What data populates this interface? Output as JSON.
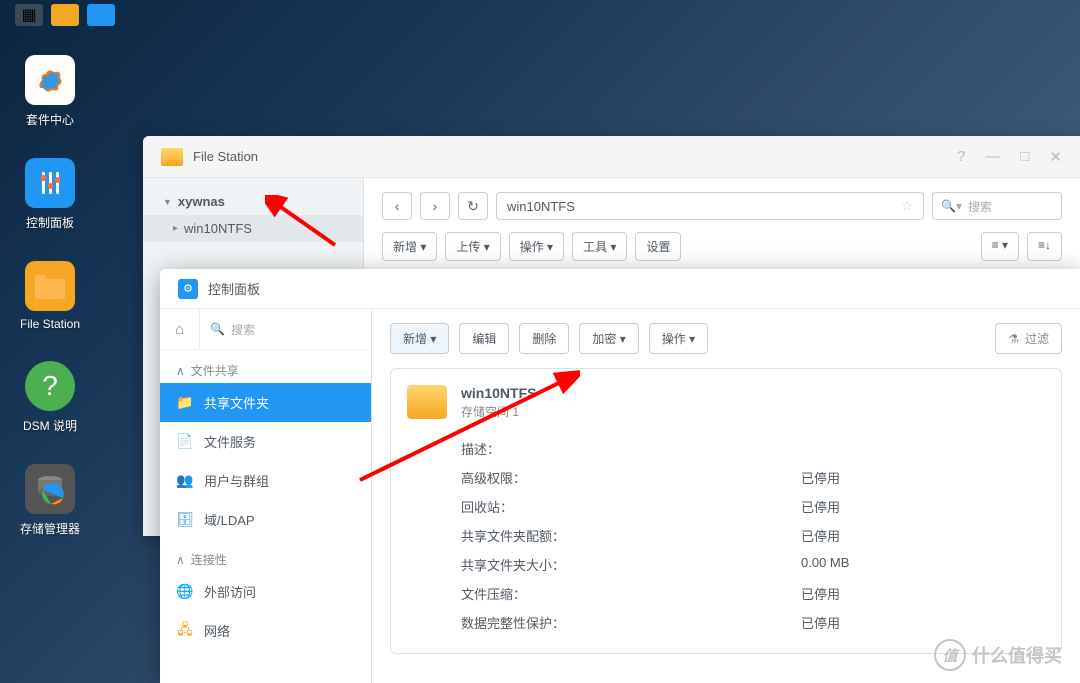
{
  "desktop": {
    "icons": [
      {
        "label": "套件中心",
        "glyph": "S"
      },
      {
        "label": "控制面板",
        "glyph": "⚙"
      },
      {
        "label": "File Station",
        "glyph": "📁"
      },
      {
        "label": "DSM 说明",
        "glyph": "?"
      },
      {
        "label": "存储管理器",
        "glyph": "💾"
      }
    ]
  },
  "fileStation": {
    "title": "File Station",
    "tree": {
      "root": "xywnas",
      "child": "win10NTFS"
    },
    "path": "win10NTFS",
    "searchPlaceholder": "搜索",
    "toolbar": {
      "new": "新增 ▾",
      "upload": "上传 ▾",
      "ops": "操作 ▾",
      "tools": "工具 ▾",
      "settings": "设置"
    }
  },
  "controlPanel": {
    "title": "控制面板",
    "searchPlaceholder": "搜索",
    "sections": {
      "fileShare": "文件共享",
      "connectivity": "连接性"
    },
    "items": {
      "sharedFolder": "共享文件夹",
      "fileServices": "文件服务",
      "usersGroups": "用户与群组",
      "domainLdap": "域/LDAP",
      "externalAccess": "外部访问",
      "network": "网络"
    },
    "toolbar": {
      "new": "新增 ▾",
      "edit": "编辑",
      "delete": "删除",
      "encrypt": "加密 ▾",
      "ops": "操作 ▾",
      "filter": "过滤"
    },
    "share": {
      "name": "win10NTFS",
      "volume": "存储空间 1",
      "rows": [
        {
          "k": "描述：",
          "v": ""
        },
        {
          "k": "高级权限：",
          "v": "已停用"
        },
        {
          "k": "回收站：",
          "v": "已停用"
        },
        {
          "k": "共享文件夹配额：",
          "v": "已停用"
        },
        {
          "k": "共享文件夹大小：",
          "v": "0.00 MB"
        },
        {
          "k": "文件压缩：",
          "v": "已停用"
        },
        {
          "k": "数据完整性保护：",
          "v": "已停用"
        }
      ]
    }
  },
  "watermark": "什么值得买"
}
